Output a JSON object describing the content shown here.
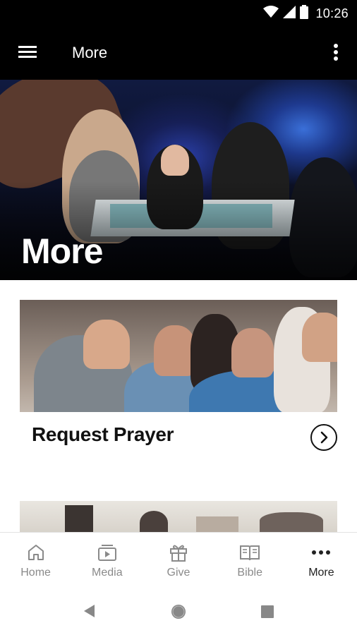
{
  "status_bar": {
    "time": "10:26",
    "icons": [
      "wifi-icon",
      "signal-icon",
      "battery-icon"
    ]
  },
  "app_bar": {
    "title": "More",
    "menu_icon": "hamburger-menu-icon",
    "overflow_icon": "more-vertical-icon"
  },
  "hero": {
    "title": "More"
  },
  "cards": [
    {
      "title": "Request Prayer",
      "action_icon": "chevron-right-circle-icon"
    }
  ],
  "bottom_nav": {
    "items": [
      {
        "label": "Home",
        "icon": "home-icon",
        "active": false
      },
      {
        "label": "Media",
        "icon": "media-icon",
        "active": false
      },
      {
        "label": "Give",
        "icon": "gift-icon",
        "active": false
      },
      {
        "label": "Bible",
        "icon": "bible-icon",
        "active": false
      },
      {
        "label": "More",
        "icon": "more-horizontal-icon",
        "active": true
      }
    ]
  },
  "system_nav": [
    "back-icon",
    "home-circle-icon",
    "recents-icon"
  ],
  "colors": {
    "app_bar": "#000000",
    "active_nav": "#222222",
    "inactive_nav": "#8a8a8a"
  }
}
